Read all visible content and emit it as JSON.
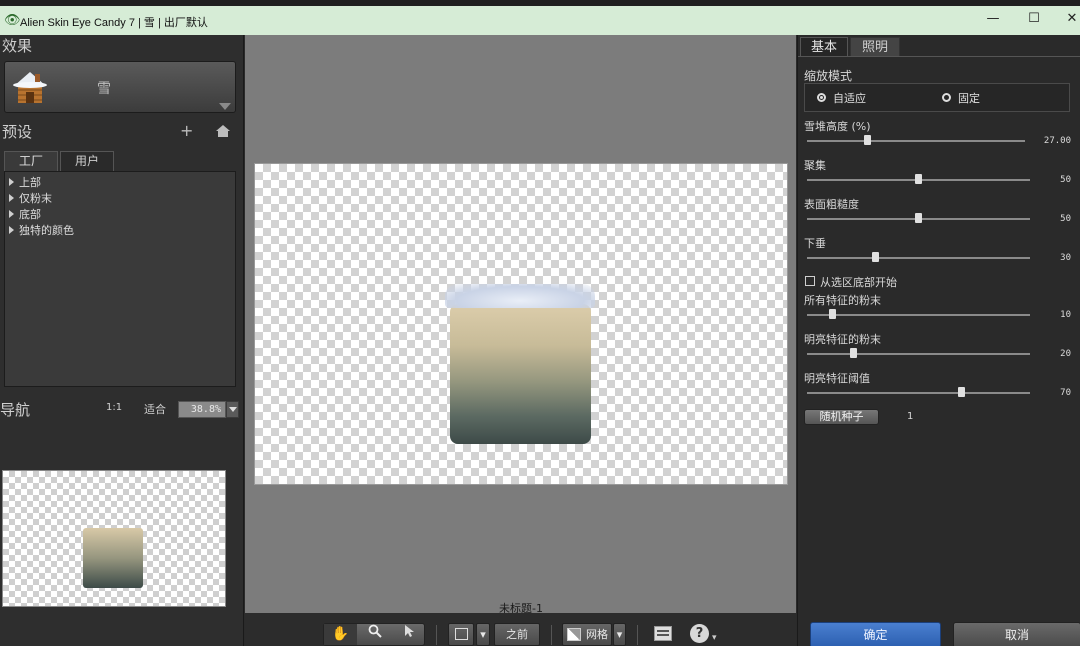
{
  "window": {
    "title": "Alien Skin Eye Candy 7 | 雪 | 出厂默认",
    "minimize": "—",
    "maximize": "☐",
    "close": "✕"
  },
  "left": {
    "effect_label": "效果",
    "effect_name": "雪",
    "preset_label": "预设",
    "add_icon": "+",
    "preset_tabs": [
      "工厂",
      "用户"
    ],
    "preset_items": [
      "上部",
      "仅粉末",
      "底部",
      "独特的颜色"
    ],
    "nav_label": "导航",
    "nav_1to1": "1:1",
    "nav_fit": "适合",
    "nav_zoom": "38.8%"
  },
  "canvas": {
    "caption": "未标题-1"
  },
  "toolbar": {
    "hand_icon": "✋",
    "zoom_icon": "🔍",
    "pointer_icon": "➤",
    "before_label": "之前",
    "grid_label": "网格",
    "help_icon": "?"
  },
  "right": {
    "tabs": [
      "基本",
      "照明"
    ],
    "zoom_mode_label": "缩放模式",
    "radio_adaptive": "自适应",
    "radio_fixed": "固定",
    "sliders": [
      {
        "label": "雪堆高度 (%)",
        "value": "27.00",
        "level": 0.27
      },
      {
        "label": "聚集",
        "value": "50",
        "level": 0.5
      },
      {
        "label": "表面粗糙度",
        "value": "50",
        "level": 0.5
      },
      {
        "label": "下垂",
        "value": "30",
        "level": 0.3
      },
      {
        "label": "所有特征的粉末",
        "value": "10",
        "level": 0.1
      },
      {
        "label": "明亮特征的粉末",
        "value": "20",
        "level": 0.2
      },
      {
        "label": "明亮特征阈值",
        "value": "70",
        "level": 0.7
      }
    ],
    "checkbox_label": "从选区底部开始",
    "seed_button": "随机种子",
    "seed_value": "1",
    "ok_button": "确定",
    "cancel_button": "取消"
  },
  "colors": {
    "ok_blue": "#2c5fb0",
    "titlebar": "#d6ecd6",
    "panel": "#2e2e2e",
    "canvas_bg": "#7c7c7c"
  }
}
